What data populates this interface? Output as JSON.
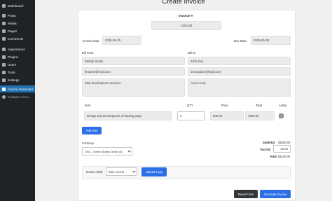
{
  "sidebar": {
    "items": [
      {
        "label": "Dashboard",
        "icon": "dashboard-icon"
      },
      {
        "label": "Posts",
        "icon": "pin-icon"
      },
      {
        "label": "Media",
        "icon": "media-icon"
      },
      {
        "label": "Pages",
        "icon": "page-icon"
      },
      {
        "label": "Comments",
        "icon": "comment-icon"
      },
      {
        "label": "Appearance",
        "icon": "brush-icon"
      },
      {
        "label": "Plugins",
        "icon": "plug-icon"
      },
      {
        "label": "Users",
        "icon": "user-icon"
      },
      {
        "label": "Tools",
        "icon": "wrench-icon"
      },
      {
        "label": "Settings",
        "icon": "settings-icon"
      },
      {
        "label": "Invoice Generator",
        "icon": "invoice-icon"
      }
    ],
    "collapse_label": "Collapse menu",
    "accent_color": "#2271b1"
  },
  "page": {
    "title": "Create Invoice"
  },
  "invoice": {
    "number_label": "Invoice #",
    "number": "1481235",
    "date_label": "Invoice Date:",
    "date": "2025-05-29",
    "due_label": "Due Date:",
    "due": "2025-05-30"
  },
  "bill_from": {
    "label": "Bill From",
    "name": "Webify Studio",
    "email": "firstuser@mail.com",
    "details": "Web development services"
  },
  "bill_to": {
    "label": "Bill To",
    "name": "John Doe",
    "email": "seconduser@mail.com",
    "details": "Acme Corp"
  },
  "items_table": {
    "headers": {
      "item": "Item",
      "qty": "QTY",
      "price": "Price",
      "total": "Total",
      "action": "Action"
    },
    "rows": [
      {
        "item": "Design and development of landing page",
        "qty": "2",
        "price": "500.00",
        "total": "1000.00",
        "action": "×"
      }
    ],
    "add_label": "Add Item"
  },
  "currency": {
    "label": "Currency",
    "selected": "USD - United States Dollar ($)"
  },
  "totals": {
    "subtotal_label": "Subtotal:",
    "subtotal": "$1000.00",
    "tax_label": "Tax (%):",
    "tax": "10.00",
    "total_label": "Total:",
    "total": "$1100.00"
  },
  "style": {
    "label": "Invoice Style",
    "selected": "Blue Accent",
    "upload_label": "Upload Logo"
  },
  "actions": {
    "reset_label": "Reset Form",
    "generate_label": "Generate Invoice",
    "primary_color": "#2c6ee8"
  }
}
